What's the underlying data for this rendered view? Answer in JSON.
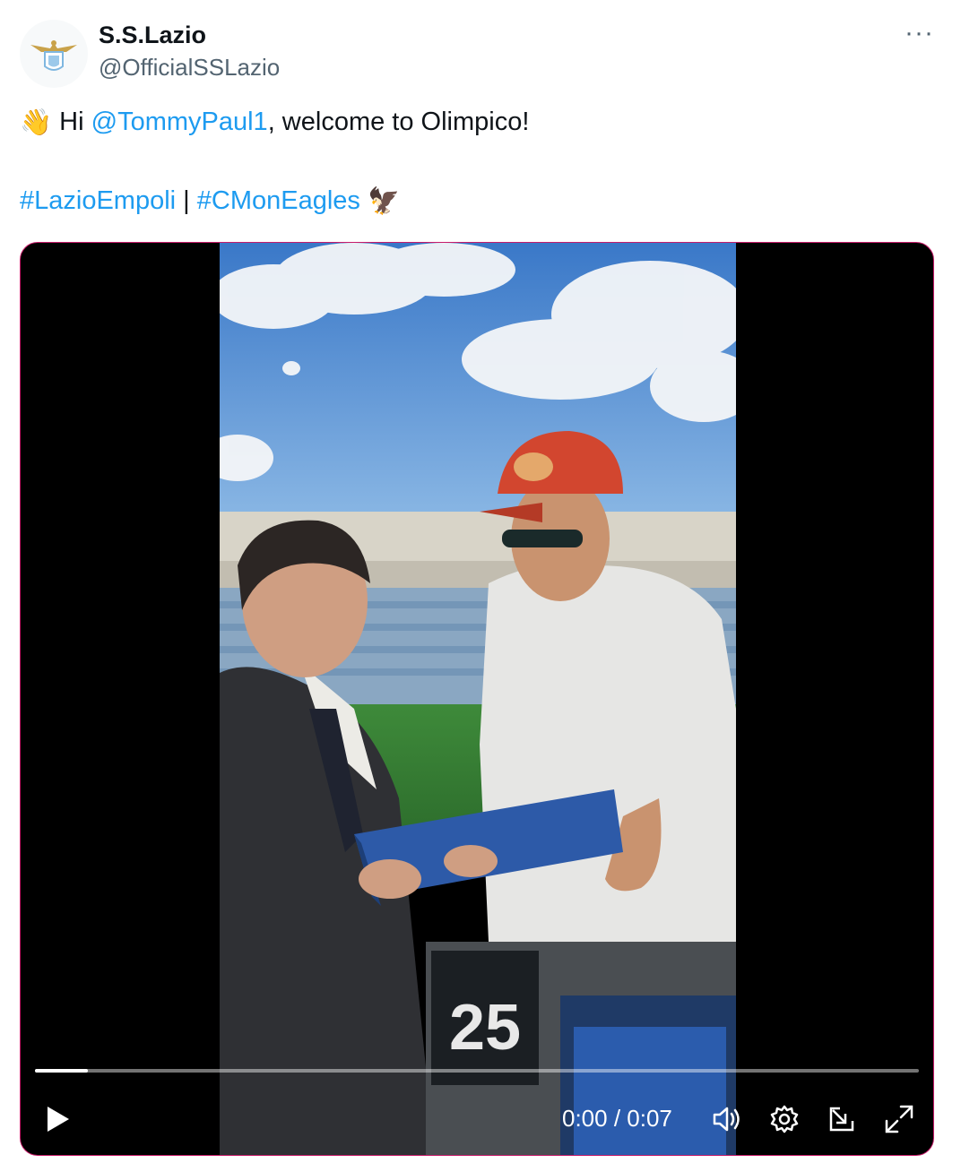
{
  "account": {
    "name": "S.S.Lazio",
    "handle": "@OfficialSSLazio"
  },
  "tweet": {
    "wave_emoji": "👋",
    "greeting": "Hi ",
    "mention": "@TommyPaul1",
    "rest": ", welcome to Olimpico!",
    "hashtag1": "#LazioEmpoli",
    "separator": " | ",
    "hashtag2": "#CMonEagles",
    "eagle_emoji": "🦅"
  },
  "menu": {
    "more_label": "···"
  },
  "video": {
    "current_time": "0:00",
    "time_separator": " / ",
    "duration": "0:07",
    "progress": 0.06,
    "seat_number": "25"
  },
  "icons": {
    "avatar": "lazio-eagle-logo",
    "play": "play-icon",
    "volume": "volume-icon",
    "settings": "gear-icon",
    "pip": "picture-in-picture-icon",
    "fullscreen": "fullscreen-icon"
  },
  "colors": {
    "link": "#1d9bf0",
    "secondary_text": "#536471",
    "media_border": "#c71c6a"
  }
}
